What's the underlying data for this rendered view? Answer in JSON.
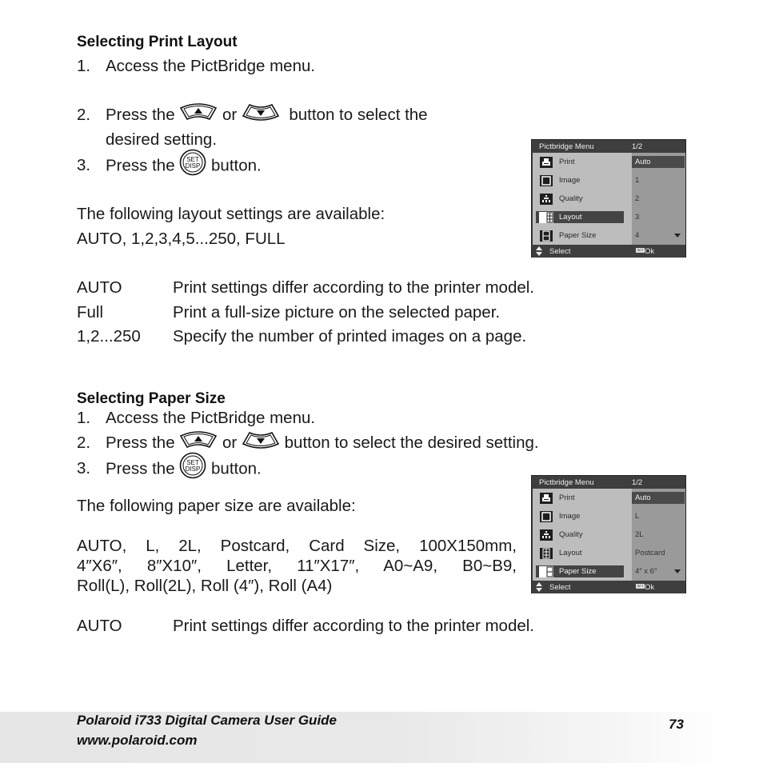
{
  "section1": {
    "heading": "Selecting Print Layout",
    "steps": [
      {
        "num": "1.",
        "text": "Access the PictBridge menu."
      },
      {
        "num": "2.",
        "pre": "Press the",
        "mid": "or",
        "post": "button to select the",
        "cont": "desired setting."
      },
      {
        "num": "3.",
        "pre": "Press the",
        "post": "button."
      }
    ],
    "avail_line1": "The following layout settings are available:",
    "avail_line2": "AUTO, 1,2,3,4,5...250, FULL",
    "definitions": [
      {
        "term": "AUTO",
        "desc": "Print settings differ according to the printer model."
      },
      {
        "term": "Full",
        "desc": "Print a full-size picture on the selected paper."
      },
      {
        "term": "1,2...250",
        "desc": "Specify the number of printed images on a page."
      }
    ]
  },
  "section2": {
    "heading": "Selecting Paper Size",
    "steps": [
      {
        "num": "1.",
        "text": "Access the PictBridge menu."
      },
      {
        "num": "2.",
        "pre": "Press the",
        "mid": "or",
        "post": "button to select the desired setting."
      },
      {
        "num": "3.",
        "pre": "Press the",
        "post": "button."
      }
    ],
    "avail_line": "The following paper size are available:",
    "list_lines": [
      "AUTO, L, 2L, Postcard, Card Size, 100X150mm,",
      "4″X6″, 8″X10″, Letter, 11″X17″, A0~A9, B0~B9,",
      "Roll(L), Roll(2L), Roll (4″), Roll (A4)"
    ],
    "definitions": [
      {
        "term": "AUTO",
        "desc": "Print settings differ according to the printer model."
      }
    ]
  },
  "icons": {
    "up_button": "up-arrow-button-icon",
    "down_button": "down-arrow-button-icon",
    "set_button": "set-disp-button-icon",
    "set_label_top": "SET",
    "set_label_bottom": "DISP"
  },
  "menu1": {
    "title": "Pictbridge Menu",
    "page": "1/2",
    "items": [
      {
        "label": "Print",
        "icon": "printer-icon"
      },
      {
        "label": "Image",
        "icon": "image-icon"
      },
      {
        "label": "Quality",
        "icon": "quality-icon"
      },
      {
        "label": "Layout",
        "icon": "layout-icon",
        "selected": true
      },
      {
        "label": "Paper Size",
        "icon": "paper-size-icon"
      }
    ],
    "options": [
      "Auto",
      "1",
      "2",
      "3",
      "4"
    ],
    "selected_option": "Auto",
    "footer_select": "Select",
    "footer_set_badge": "SET",
    "footer_ok": "Ok"
  },
  "menu2": {
    "title": "Pictbridge Menu",
    "page": "1/2",
    "items": [
      {
        "label": "Print",
        "icon": "printer-icon"
      },
      {
        "label": "Image",
        "icon": "image-icon"
      },
      {
        "label": "Quality",
        "icon": "quality-icon"
      },
      {
        "label": "Layout",
        "icon": "layout-icon"
      },
      {
        "label": "Paper Size",
        "icon": "paper-size-icon",
        "selected": true
      }
    ],
    "options": [
      "Auto",
      "L",
      "2L",
      "Postcard",
      "4″ x 6″"
    ],
    "selected_option": "Auto",
    "footer_select": "Select",
    "footer_set_badge": "SET",
    "footer_ok": "Ok"
  },
  "footer": {
    "title": "Polaroid i733 Digital Camera User Guide",
    "url": "www.polaroid.com",
    "page_number": "73"
  }
}
